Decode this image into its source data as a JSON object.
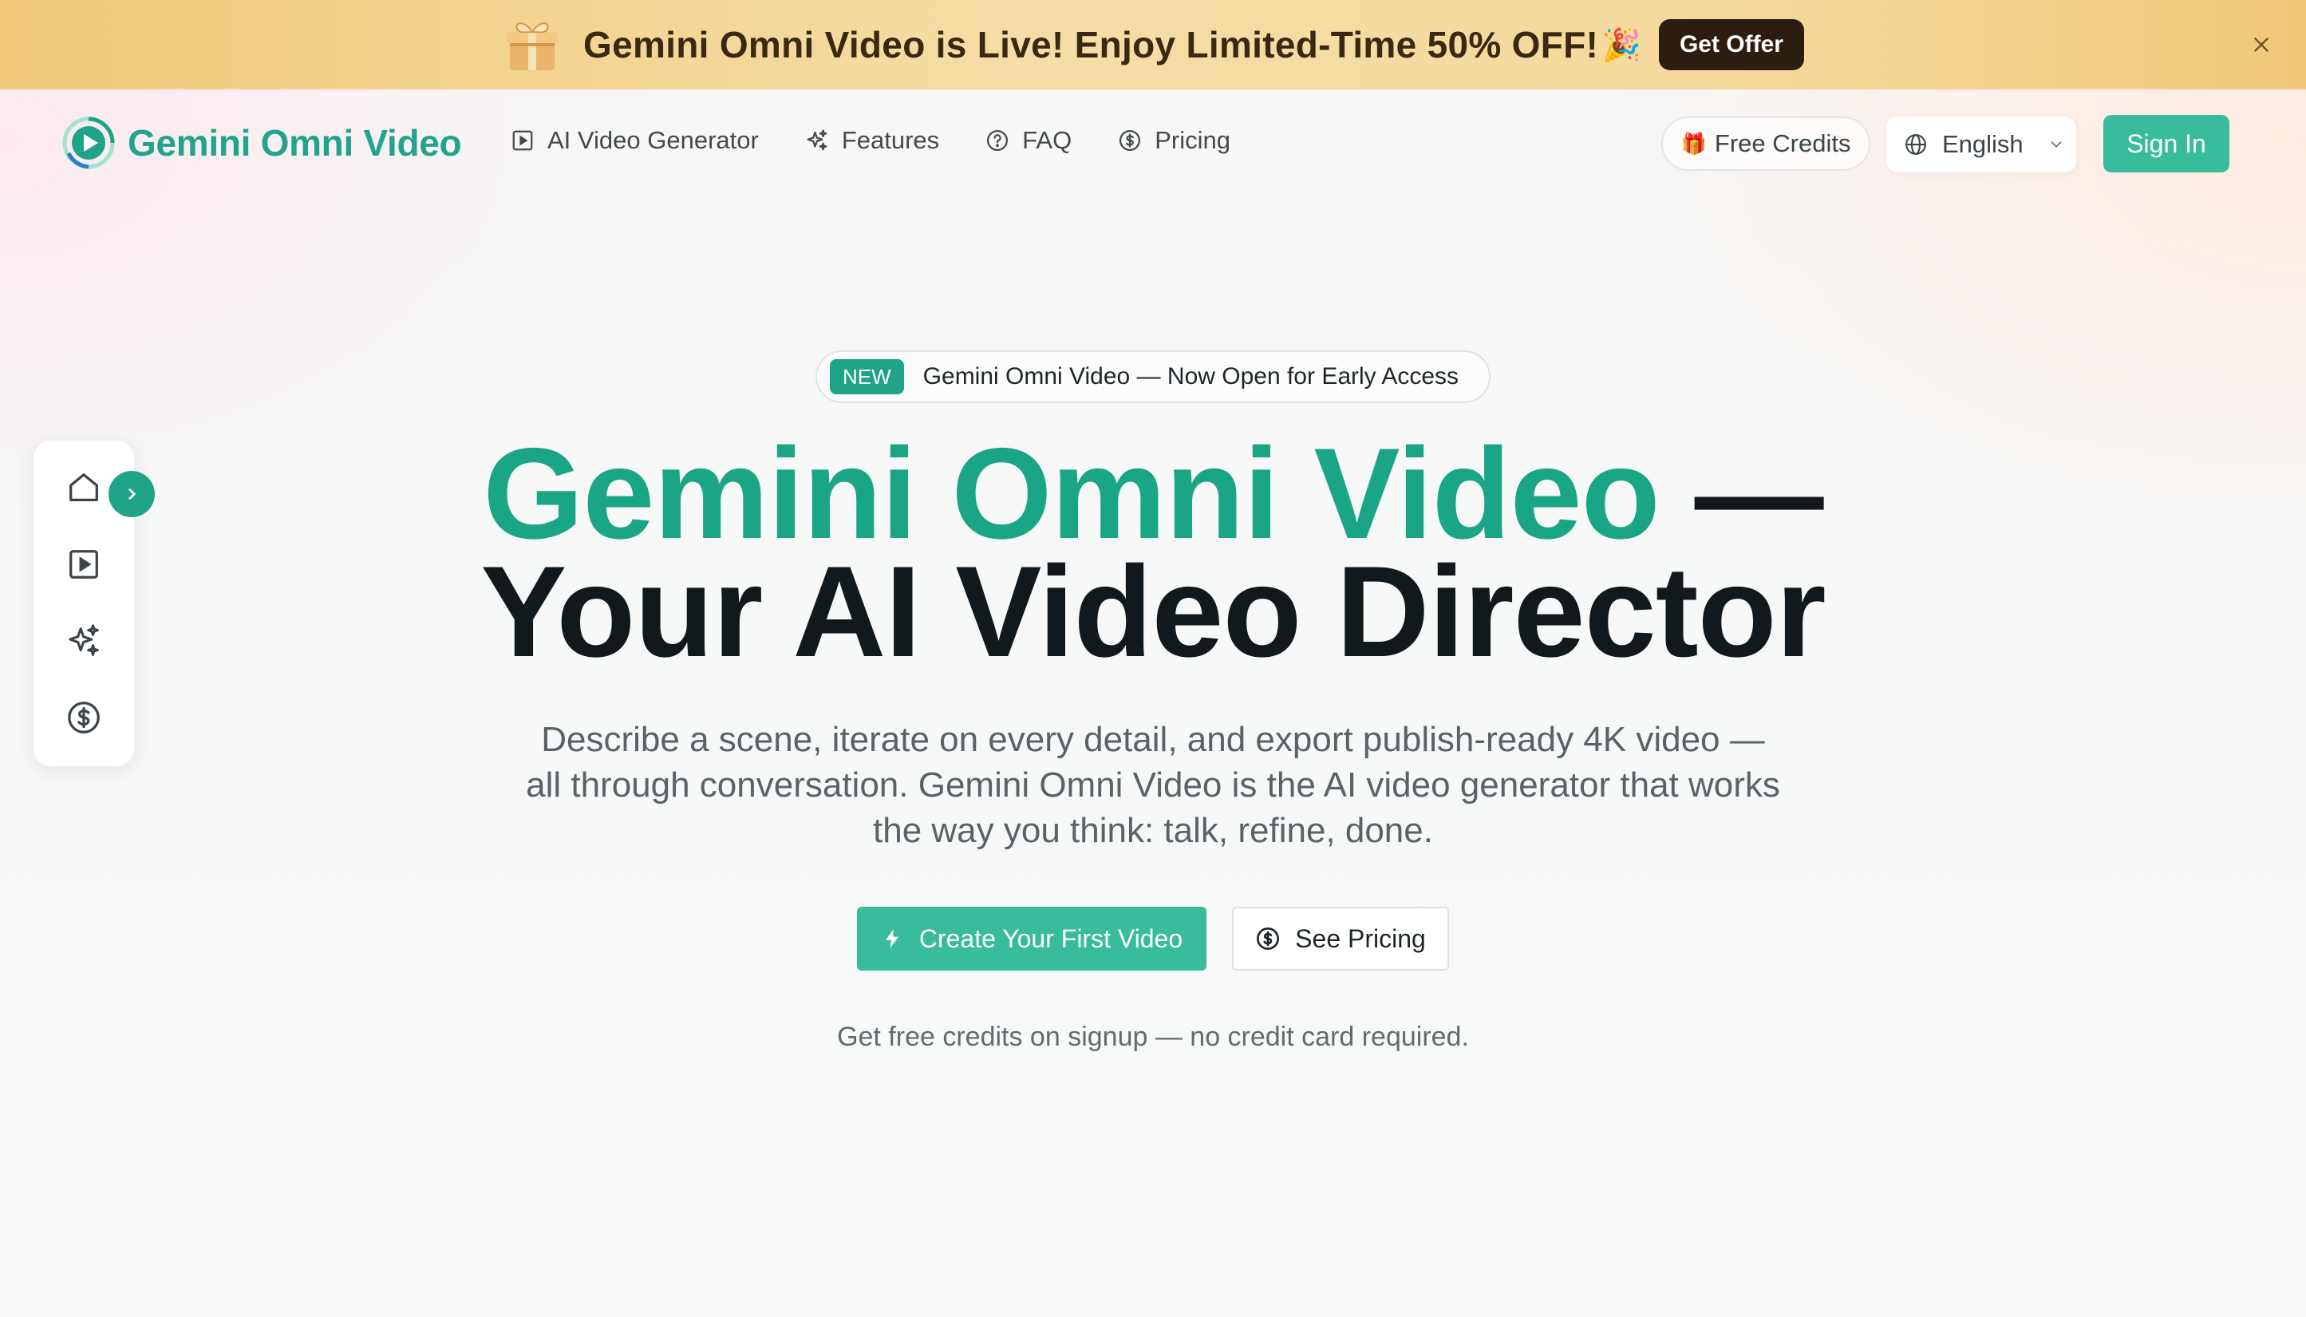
{
  "promo": {
    "text": "Gemini Omni Video is Live! Enjoy Limited-Time 50% OFF!",
    "confetti": "🎉",
    "button_label": "Get Offer"
  },
  "header": {
    "logo_text": "Gemini Omni Video",
    "nav": [
      {
        "label": "AI Video Generator",
        "icon": "play-square-icon"
      },
      {
        "label": "Features",
        "icon": "sparkles-icon"
      },
      {
        "label": "FAQ",
        "icon": "help-circle-icon"
      },
      {
        "label": "Pricing",
        "icon": "dollar-circle-icon"
      }
    ],
    "free_credits_label": "Free Credits",
    "language": "English",
    "sign_in_label": "Sign In"
  },
  "rail": {
    "icons": [
      "home-icon",
      "play-square-icon",
      "sparkles-icon",
      "dollar-circle-icon"
    ],
    "toggle_icon": "chevron-right-icon"
  },
  "hero": {
    "badge_tag": "NEW",
    "badge_text": "Gemini Omni Video — Now Open for Early Access",
    "title_accent": "Gemini Omni Video",
    "title_dash": "—",
    "title_line2": "Your AI Video Director",
    "subtitle": "Describe a scene, iterate on every detail, and export publish-ready 4K video — all through conversation. Gemini Omni Video is the AI video generator that works the way you think: talk, refine, done.",
    "primary_cta": "Create Your First Video",
    "secondary_cta": "See Pricing",
    "note": "Get free credits on signup — no credit card required."
  },
  "colors": {
    "brand": "#1fa487",
    "button": "#38bc9b",
    "banner": "#f4d596",
    "text_dark": "#12191c"
  }
}
